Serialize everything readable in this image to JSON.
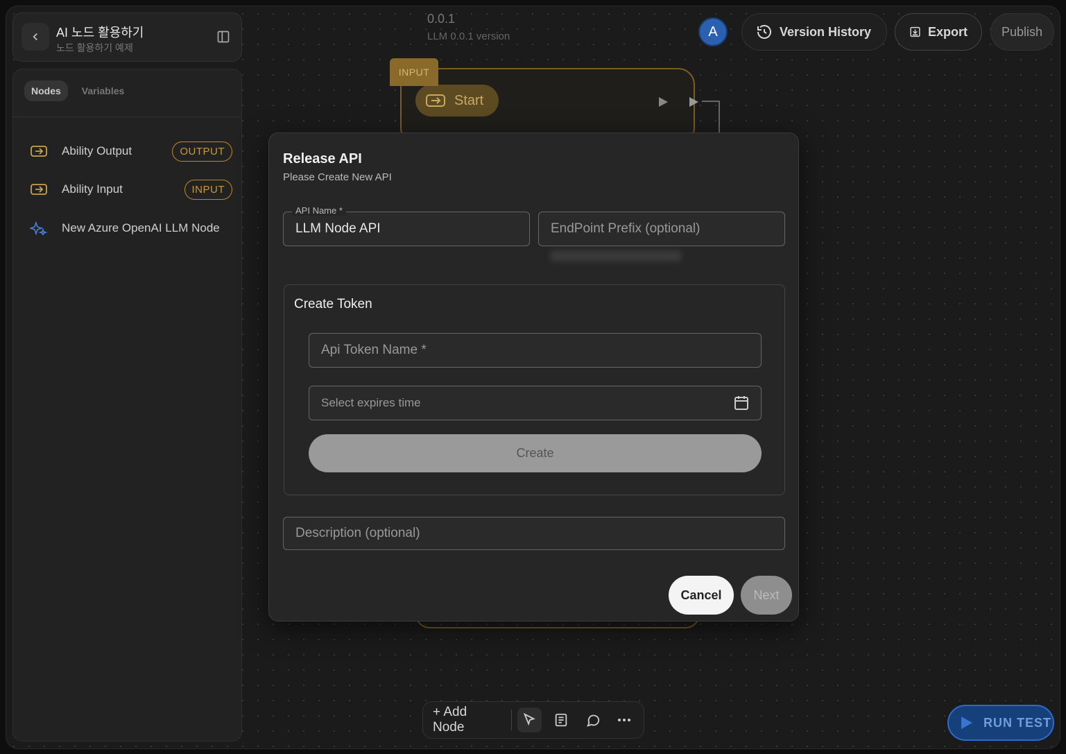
{
  "project": {
    "title": "AI 노드 활용하기",
    "subtitle": "노드 활용하기 예제"
  },
  "sidebar": {
    "tabs": [
      "Nodes",
      "Variables"
    ],
    "active_tab": "Nodes",
    "items": [
      {
        "label": "Ability Output",
        "badge": "OUTPUT",
        "icon": "input-arrow-icon"
      },
      {
        "label": "Ability Input",
        "badge": "INPUT",
        "icon": "input-arrow-icon"
      },
      {
        "label": "New Azure OpenAI LLM Node",
        "badge": "",
        "icon": "sparkle-icon"
      }
    ]
  },
  "header": {
    "version": "0.0.1",
    "version_sub": "LLM 0.0.1 version",
    "avatar": "A",
    "version_history_label": "Version History",
    "export_label": "Export",
    "publish_label": "Publish"
  },
  "canvas": {
    "input_tag": "INPUT",
    "start_label": "Start"
  },
  "modal": {
    "title": "Release API",
    "subtitle": "Please Create New API",
    "api_name_label": "API Name *",
    "api_name_value": "LLM Node API",
    "endpoint_placeholder": "EndPoint Prefix (optional)",
    "token_section_title": "Create Token",
    "token_name_placeholder": "Api Token Name *",
    "expires_placeholder": "Select expires time",
    "create_label": "Create",
    "description_placeholder": "Description (optional)",
    "cancel_label": "Cancel",
    "next_label": "Next"
  },
  "toolbar": {
    "add_node_label": "+ Add Node"
  },
  "run_test_label": "RUN TEST",
  "colors": {
    "accent_gold": "#c79a3d",
    "avatar_blue": "#2b5fb0",
    "run_test_blue": "#16407a"
  }
}
